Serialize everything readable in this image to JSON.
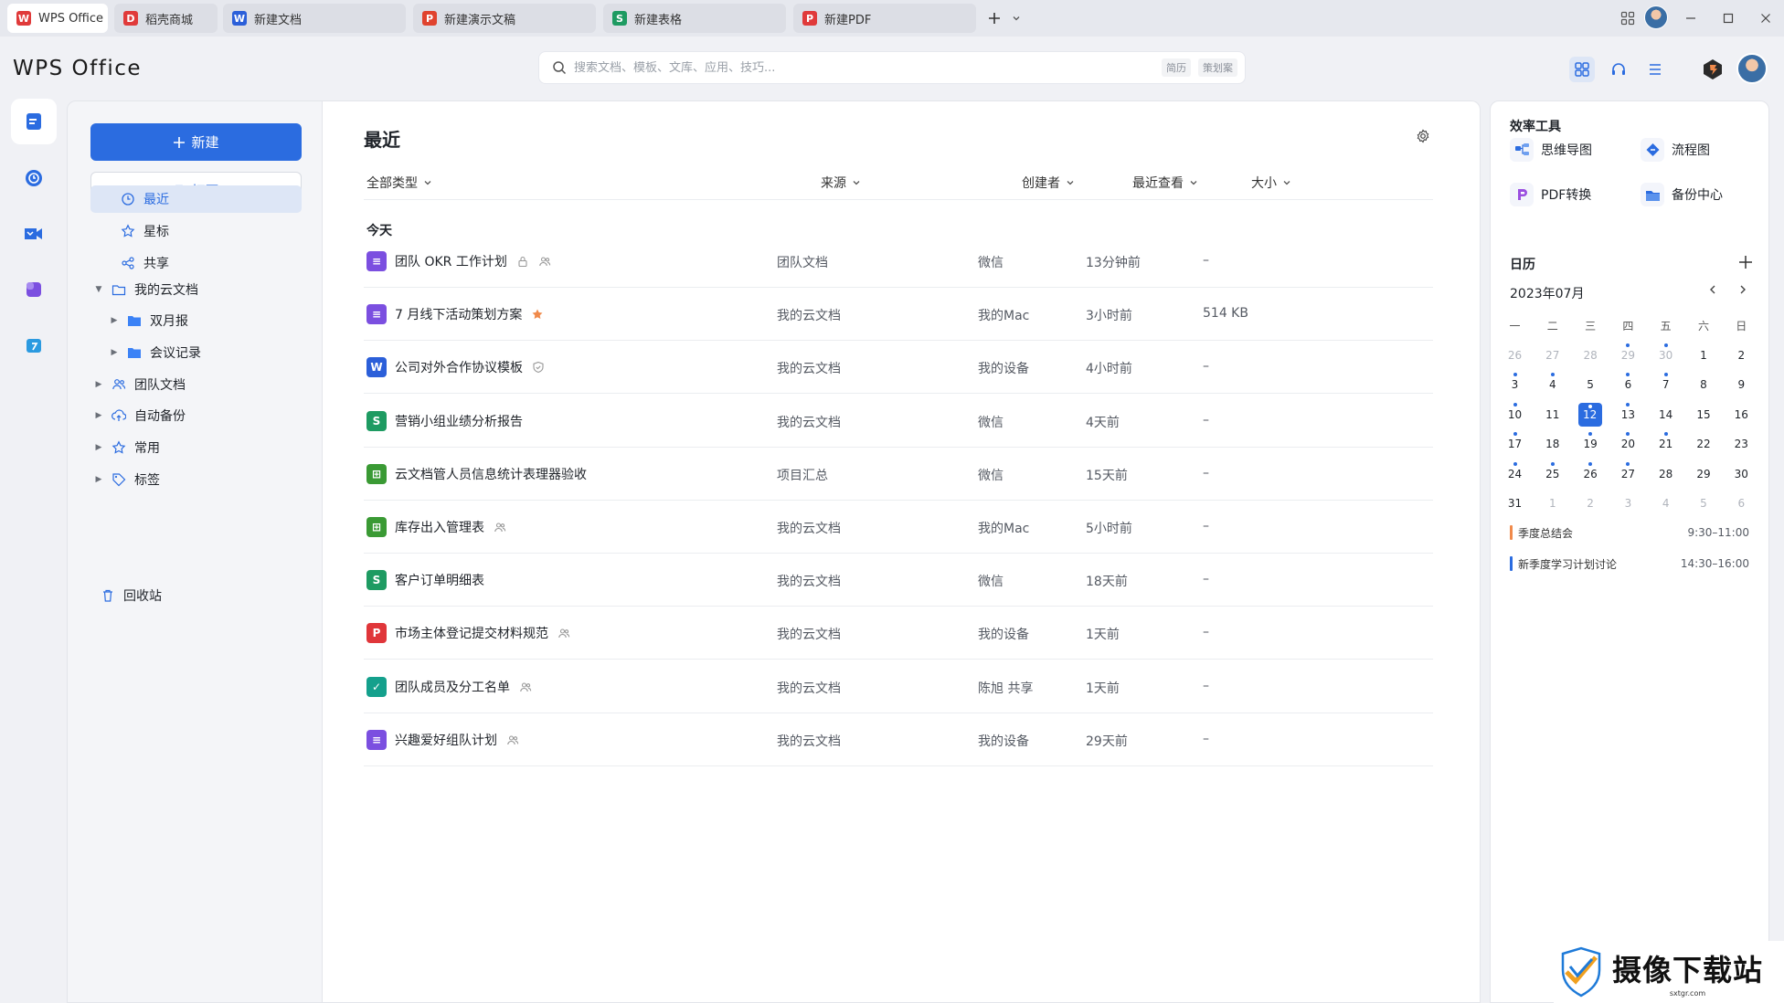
{
  "tabs": [
    {
      "label": "WPS Office",
      "icon": "wps-logo-icon",
      "color": "#e03a3a",
      "glyph": "W",
      "active": true
    },
    {
      "label": "稻壳商城",
      "icon": "docer-icon",
      "color": "#e03a3a",
      "glyph": "D"
    },
    {
      "label": "新建文档",
      "icon": "word-doc-icon",
      "color": "#2b5fd9",
      "glyph": "W"
    },
    {
      "label": "新建演示文稿",
      "icon": "presentation-icon",
      "color": "#e0432e",
      "glyph": "P"
    },
    {
      "label": "新建表格",
      "icon": "spreadsheet-icon",
      "color": "#1e9b62",
      "glyph": "S"
    },
    {
      "label": "新建PDF",
      "icon": "pdf-icon",
      "color": "#e03a3a",
      "glyph": "P"
    }
  ],
  "logo": "WPS Office",
  "search": {
    "placeholder": "搜索文档、模板、文库、应用、技巧...",
    "chips": [
      "简历",
      "策划案"
    ]
  },
  "sidebar": {
    "new_label": "新建",
    "open_label": "打开",
    "nav": [
      {
        "label": "最近",
        "icon": "clock-icon",
        "active": true
      },
      {
        "label": "星标",
        "icon": "star-icon"
      },
      {
        "label": "共享",
        "icon": "share-icon"
      }
    ],
    "tree": [
      {
        "label": "我的云文档",
        "icon": "cloud-folder-icon",
        "expanded": true
      },
      {
        "label": "双月报",
        "icon": "folder-icon",
        "child": true
      },
      {
        "label": "会议记录",
        "icon": "folder-icon",
        "child": true
      },
      {
        "label": "团队文档",
        "icon": "team-icon"
      },
      {
        "label": "自动备份",
        "icon": "backup-icon"
      },
      {
        "label": "常用",
        "icon": "pin-icon"
      },
      {
        "label": "标签",
        "icon": "tag-icon"
      }
    ],
    "trash_label": "回收站"
  },
  "main": {
    "title": "最近",
    "columns": [
      "全部类型",
      "来源",
      "创建者",
      "最近查看",
      "大小"
    ],
    "group_label": "今天",
    "rows": [
      {
        "name": "团队 OKR 工作计划",
        "type": "doc",
        "icon_color": "#7b4fe0",
        "glyph": "≡",
        "badges": [
          "lock-icon",
          "team-icon"
        ],
        "source": "团队文档",
        "creator": "微信",
        "viewed": "13分钟前",
        "size": "–"
      },
      {
        "name": "7 月线下活动策划方案",
        "type": "doc",
        "icon_color": "#7b4fe0",
        "glyph": "≡",
        "badges": [
          "star-filled-icon"
        ],
        "source": "我的云文档",
        "creator": "我的Mac",
        "viewed": "3小时前",
        "size": "514 KB"
      },
      {
        "name": "公司对外合作协议模板",
        "type": "word",
        "icon_color": "#2b5fd9",
        "glyph": "W",
        "badges": [
          "shield-icon"
        ],
        "source": "我的云文档",
        "creator": "我的设备",
        "viewed": "4小时前",
        "size": "–"
      },
      {
        "name": "营销小组业绩分析报告",
        "type": "sheet",
        "icon_color": "#1e9b62",
        "glyph": "S",
        "badges": [],
        "source": "我的云文档",
        "creator": "微信",
        "viewed": "4天前",
        "size": "–"
      },
      {
        "name": "云文档管人员信息统计表理器验收",
        "type": "table",
        "icon_color": "#3a9a34",
        "glyph": "⊞",
        "badges": [],
        "source": "项目汇总",
        "creator": "微信",
        "viewed": "15天前",
        "size": "–"
      },
      {
        "name": "库存出入管理表",
        "type": "table",
        "icon_color": "#3a9a34",
        "glyph": "⊞",
        "badges": [
          "team-icon"
        ],
        "source": "我的云文档",
        "creator": "我的Mac",
        "viewed": "5小时前",
        "size": "–"
      },
      {
        "name": "客户订单明细表",
        "type": "sheet",
        "icon_color": "#1e9b62",
        "glyph": "S",
        "badges": [],
        "source": "我的云文档",
        "creator": "微信",
        "viewed": "18天前",
        "size": "–"
      },
      {
        "name": "市场主体登记提交材料规范",
        "type": "pdf",
        "icon_color": "#e0363a",
        "glyph": "P",
        "badges": [
          "team-icon"
        ],
        "source": "我的云文档",
        "creator": "我的设备",
        "viewed": "1天前",
        "size": "–"
      },
      {
        "name": "团队成员及分工名单",
        "type": "form",
        "icon_color": "#14a08c",
        "glyph": "✓",
        "badges": [
          "team-icon"
        ],
        "source": "我的云文档",
        "creator": "陈旭 共享",
        "viewed": "1天前",
        "size": "–"
      },
      {
        "name": "兴趣爱好组队计划",
        "type": "doc",
        "icon_color": "#7b4fe0",
        "glyph": "≡",
        "badges": [
          "team-icon"
        ],
        "source": "我的云文档",
        "creator": "我的设备",
        "viewed": "29天前",
        "size": "–"
      }
    ]
  },
  "right": {
    "tools_title": "效率工具",
    "tools": [
      {
        "label": "思维导图",
        "icon": "mindmap-icon"
      },
      {
        "label": "流程图",
        "icon": "flowchart-icon"
      },
      {
        "label": "PDF转换",
        "icon": "pdf-convert-icon"
      },
      {
        "label": "备份中心",
        "icon": "backup-center-icon"
      }
    ],
    "calendar_title": "日历",
    "month": "2023年07月",
    "weekdays": [
      "一",
      "二",
      "三",
      "四",
      "五",
      "六",
      "日"
    ],
    "days": [
      {
        "d": "26",
        "m": true
      },
      {
        "d": "27",
        "m": true
      },
      {
        "d": "28",
        "m": true
      },
      {
        "d": "29",
        "m": true,
        "dot": true
      },
      {
        "d": "30",
        "m": true,
        "dot": true
      },
      {
        "d": "1"
      },
      {
        "d": "2"
      },
      {
        "d": "3",
        "dot": true
      },
      {
        "d": "4",
        "dot": true
      },
      {
        "d": "5"
      },
      {
        "d": "6",
        "dot": true
      },
      {
        "d": "7",
        "dot": true
      },
      {
        "d": "8"
      },
      {
        "d": "9"
      },
      {
        "d": "10",
        "dot": true
      },
      {
        "d": "11"
      },
      {
        "d": "12",
        "sel": true,
        "dot": true
      },
      {
        "d": "13",
        "dot": true
      },
      {
        "d": "14"
      },
      {
        "d": "15"
      },
      {
        "d": "16"
      },
      {
        "d": "17",
        "dot": true
      },
      {
        "d": "18"
      },
      {
        "d": "19",
        "dot": true
      },
      {
        "d": "20",
        "dot": true
      },
      {
        "d": "21",
        "dot": true
      },
      {
        "d": "22"
      },
      {
        "d": "23"
      },
      {
        "d": "24",
        "dot": true
      },
      {
        "d": "25",
        "dot": true
      },
      {
        "d": "26",
        "dot": true
      },
      {
        "d": "27",
        "dot": true
      },
      {
        "d": "28"
      },
      {
        "d": "29"
      },
      {
        "d": "30"
      },
      {
        "d": "31"
      },
      {
        "d": "1",
        "m": true
      },
      {
        "d": "2",
        "m": true
      },
      {
        "d": "3",
        "m": true
      },
      {
        "d": "4",
        "m": true
      },
      {
        "d": "5",
        "m": true
      },
      {
        "d": "6",
        "m": true
      }
    ],
    "events": [
      {
        "title": "季度总结会",
        "time": "9:30–11:00",
        "color": "#f08a4b"
      },
      {
        "title": "新季度学习计划讨论",
        "time": "14:30–16:00",
        "color": "#2b6ce0"
      }
    ]
  },
  "watermark": {
    "big": "摄像下载站",
    "small": "sxtgr.com"
  },
  "colors": {
    "accent": "#2b6ce0",
    "star": "#f08a4b"
  }
}
